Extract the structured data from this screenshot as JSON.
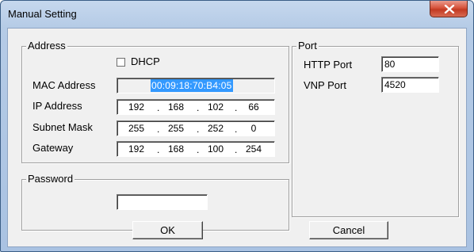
{
  "window": {
    "title": "Manual Setting"
  },
  "address": {
    "legend": "Address",
    "dhcp_label": "DHCP",
    "dhcp_checked": false,
    "mac_label": "MAC Address",
    "mac_value": "00:09:18:70:B4:05",
    "ip_label": "IP Address",
    "ip": [
      "192",
      "168",
      "102",
      "66"
    ],
    "subnet_label": "Subnet Mask",
    "subnet": [
      "255",
      "255",
      "252",
      "0"
    ],
    "gateway_label": "Gateway",
    "gateway": [
      "192",
      "168",
      "100",
      "254"
    ]
  },
  "password": {
    "legend": "Password",
    "value": ""
  },
  "port": {
    "legend": "Port",
    "http_label": "HTTP Port",
    "http_value": "80",
    "vnp_label": "VNP Port",
    "vnp_value": "4520"
  },
  "buttons": {
    "ok": "OK",
    "cancel": "Cancel"
  },
  "icons": {
    "close": "close-icon"
  }
}
